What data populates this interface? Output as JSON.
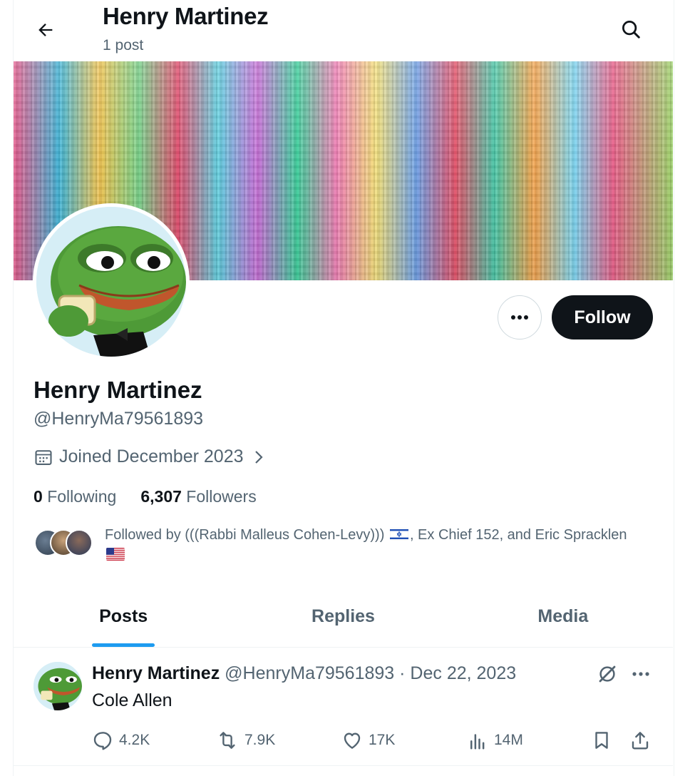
{
  "header": {
    "title": "Henry Martinez",
    "post_count": "1 post"
  },
  "profile": {
    "name": "Henry Martinez",
    "handle": "@HenryMa79561893",
    "joined": "Joined December 2023",
    "follow_label": "Follow",
    "following_count": "0",
    "following_label": "Following",
    "followers_count": "6,307",
    "followers_label": "Followers",
    "followed_by_prefix": "Followed by (((Rabbi Malleus Cohen-Levy)))",
    "followed_by_middle": ", Ex Chief 152, and Eric Spracklen"
  },
  "tabs": [
    {
      "label": "Posts",
      "active": true
    },
    {
      "label": "Replies",
      "active": false
    },
    {
      "label": "Media",
      "active": false
    }
  ],
  "post": {
    "author_name": "Henry Martinez",
    "author_meta": "@HenryMa79561893 · Dec 22, 2023",
    "text": "Cole Allen",
    "replies": "4.2K",
    "reposts": "7.9K",
    "likes": "17K",
    "views": "14M"
  },
  "colors": {
    "accent": "#1d9bf0",
    "text_primary": "#0f1419",
    "text_secondary": "#536471",
    "pepe_green": "#4e9a37"
  }
}
